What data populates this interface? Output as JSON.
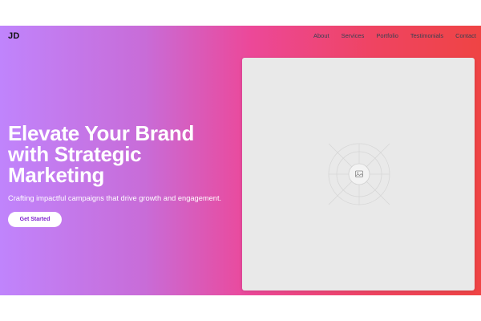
{
  "header": {
    "logo": "JD",
    "nav": [
      {
        "label": "About"
      },
      {
        "label": "Services"
      },
      {
        "label": "Portfolio"
      },
      {
        "label": "Testimonials"
      },
      {
        "label": "Contact"
      }
    ]
  },
  "hero": {
    "headline": "Elevate Your Brand with Strategic Marketing",
    "subheadline": "Crafting impactful campaigns that drive growth and engagement.",
    "cta_label": "Get Started",
    "image_icon": "image-placeholder-icon"
  },
  "colors": {
    "gradient_start": "#c084fc",
    "gradient_mid": "#ec4899",
    "gradient_end": "#ef4444",
    "cta_text": "#7e22ce",
    "headline_text": "#ffffff"
  }
}
